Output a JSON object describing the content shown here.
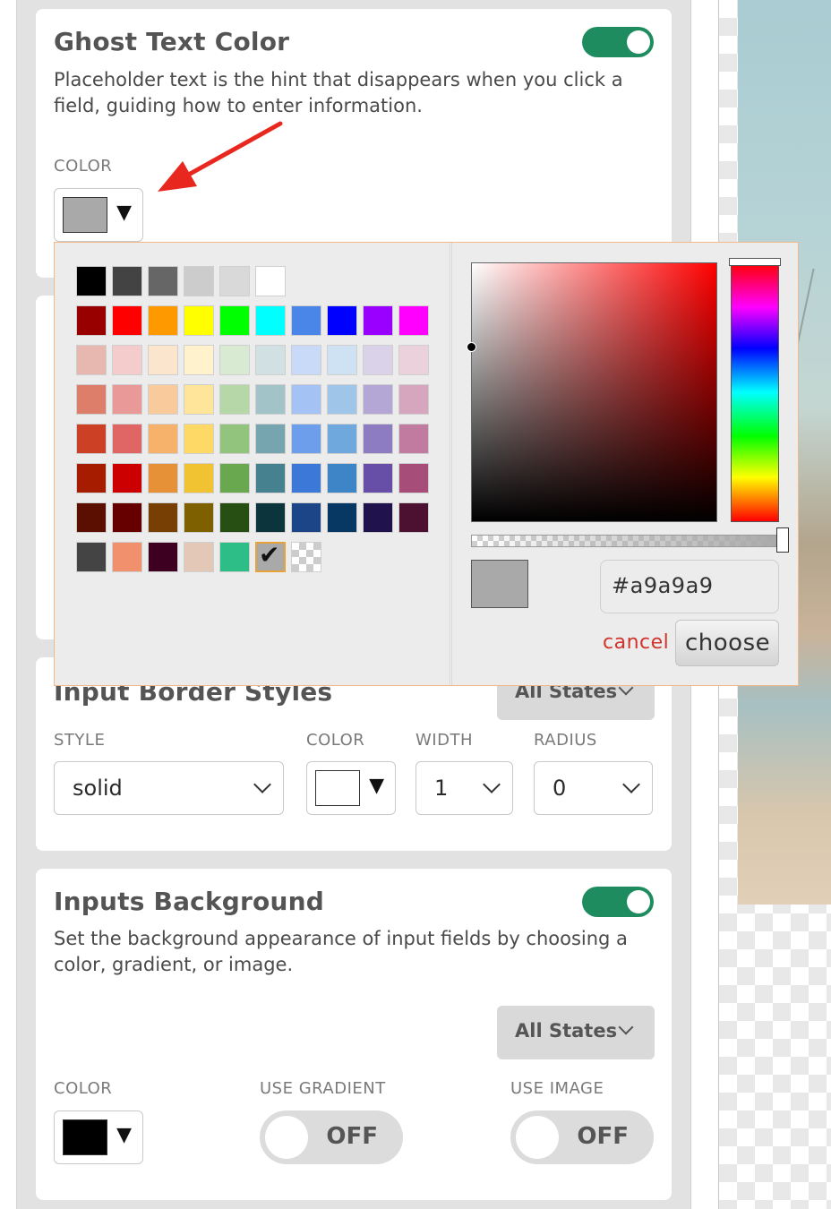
{
  "ghost_text": {
    "title": "Ghost Text Color",
    "description": "Placeholder text is the hint that disappears when you click a field, guiding how to enter information.",
    "color_label": "COLOR",
    "toggle_on": true,
    "selected_color": "#a9a9a9"
  },
  "border_styles": {
    "title": "Input Border Styles",
    "states": "All States",
    "style_label": "STYLE",
    "style_value": "solid",
    "color_label": "COLOR",
    "color_value": "#ffffff",
    "width_label": "WIDTH",
    "width_value": "1",
    "radius_label": "RADIUS",
    "radius_value": "0"
  },
  "inputs_background": {
    "title": "Inputs Background",
    "description": "Set the background appearance of input fields by choosing a color, gradient, or image.",
    "toggle_on": true,
    "states": "All States",
    "color_label": "COLOR",
    "color_value": "#000000",
    "gradient_label": "USE GRADIENT",
    "gradient_state": "OFF",
    "image_label": "USE IMAGE",
    "image_state": "OFF"
  },
  "color_picker": {
    "hex_value": "#a9a9a9",
    "cancel_label": "cancel",
    "choose_label": "choose",
    "palette_rows": [
      [
        "#000000",
        "#434343",
        "#666666",
        "#cccccc",
        "#d9d9d9",
        "#ffffff"
      ],
      [
        "#980000",
        "#ff0000",
        "#ff9900",
        "#ffff00",
        "#00ff00",
        "#00ffff",
        "#4a86e8",
        "#0000ff",
        "#9900ff",
        "#ff00ff"
      ],
      [
        "#e6b8af",
        "#f4cccc",
        "#fce5cd",
        "#fff2cc",
        "#d9ead3",
        "#d0e0e3",
        "#c9daf8",
        "#cfe2f3",
        "#d9d2e9",
        "#ead1dc"
      ],
      [
        "#dd7e6b",
        "#ea9999",
        "#f9cb9c",
        "#ffe599",
        "#b6d7a8",
        "#a2c4c9",
        "#a4c2f4",
        "#9fc5e8",
        "#b4a7d6",
        "#d5a6bd"
      ],
      [
        "#cc4125",
        "#e06666",
        "#f6b26b",
        "#ffd966",
        "#93c47d",
        "#76a5af",
        "#6d9eeb",
        "#6fa8dc",
        "#8e7cc3",
        "#c27ba0"
      ],
      [
        "#a61c00",
        "#cc0000",
        "#e69138",
        "#f1c232",
        "#6aa84f",
        "#45818e",
        "#3c78d8",
        "#3d85c6",
        "#674ea7",
        "#a64d79"
      ],
      [
        "#5b0f00",
        "#660000",
        "#783f04",
        "#7f6000",
        "#274e13",
        "#0c343d",
        "#1c4587",
        "#073763",
        "#20124d",
        "#4c1130"
      ],
      [
        "#444444",
        "#f0906c",
        "#3d0020",
        "#e3c8b8",
        "#2dbe88",
        "#a9a9a9",
        "transparent"
      ]
    ],
    "selected_swatch": "#a9a9a9",
    "hue_color": "#ff0000",
    "border_accent": "#f0b987"
  },
  "annotation": {
    "arrow_color": "#e8281e"
  },
  "colors": {
    "toggle_green": "#1f8c5f",
    "panel_bg": "#e2e2e2"
  }
}
